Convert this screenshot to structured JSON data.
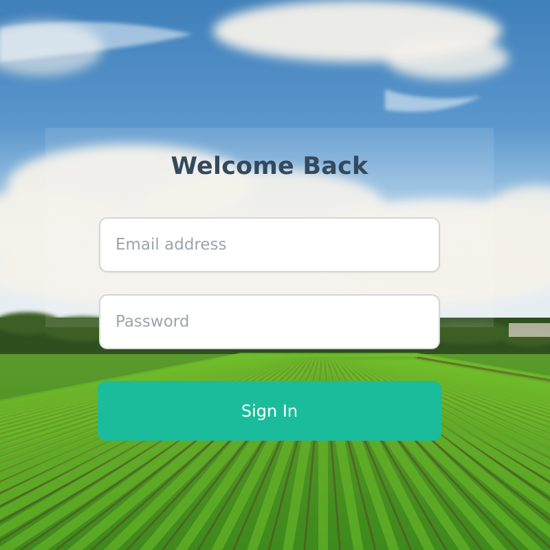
{
  "login": {
    "title": "Welcome Back",
    "email_placeholder": "Email address",
    "password_placeholder": "Password",
    "submit_label": "Sign In"
  },
  "colors": {
    "title": "#34495e",
    "button": "#1abc9c",
    "button_text": "#ffffff",
    "input_bg": "#ffffff",
    "input_border": "#d3d7d8",
    "placeholder": "#9aa4ad"
  }
}
